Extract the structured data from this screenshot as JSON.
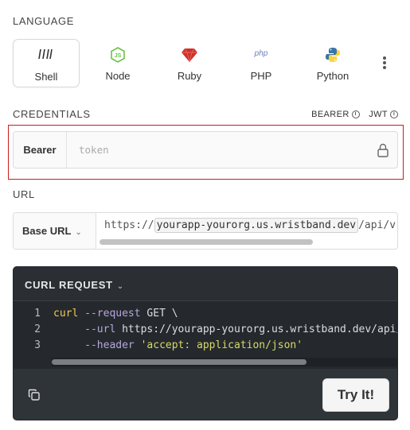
{
  "language": {
    "title": "LANGUAGE",
    "options": [
      {
        "label": "Shell",
        "icon": "shell-icon",
        "active": true
      },
      {
        "label": "Node",
        "icon": "node-icon",
        "active": false
      },
      {
        "label": "Ruby",
        "icon": "ruby-icon",
        "active": false
      },
      {
        "label": "PHP",
        "icon": "php-icon",
        "active": false
      },
      {
        "label": "Python",
        "icon": "python-icon",
        "active": false
      }
    ],
    "more_icon": "more-vertical-icon"
  },
  "credentials": {
    "title": "CREDENTIALS",
    "auth_options": [
      "BEARER",
      "JWT"
    ],
    "bearer_label": "Bearer",
    "token_placeholder": "token",
    "token_value": ""
  },
  "url": {
    "title": "URL",
    "base_url_label": "Base URL",
    "scheme": "https://",
    "host": "yourapp-yourorg.us.wristband.dev",
    "path": "/api/v"
  },
  "curl": {
    "title": "CURL REQUEST",
    "lines": [
      {
        "num": "1",
        "cmd": "curl",
        "flag": "--request",
        "rest": " GET \\"
      },
      {
        "num": "2",
        "flag": "--url",
        "rest": " https://yourapp-yourorg.us.wristband.dev/api/"
      },
      {
        "num": "3",
        "flag": "--header",
        "str": "'accept: application/json'"
      }
    ],
    "try_label": "Try It!"
  },
  "colors": {
    "highlight": "#c81e1e",
    "node": "#6cc24a",
    "ruby": "#cc342d",
    "python_blue": "#3776ab",
    "python_yellow": "#ffd43b",
    "php": "#6c7eb7"
  }
}
